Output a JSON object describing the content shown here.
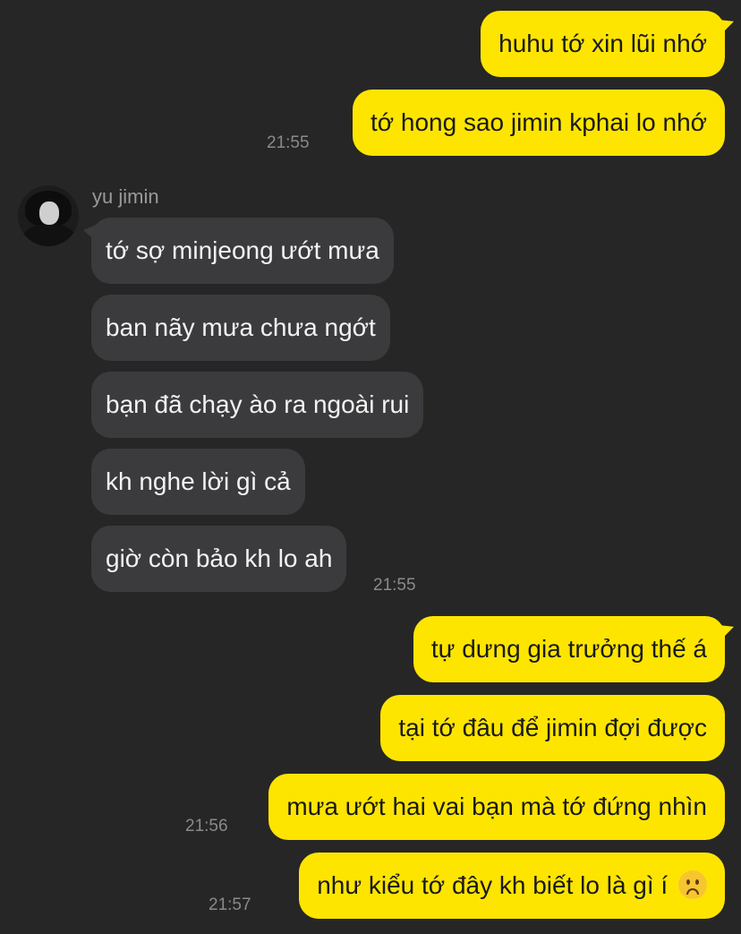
{
  "contact": {
    "name": "yu jimin"
  },
  "messages": [
    {
      "text": "huhu tớ xin lũi nhớ"
    },
    {
      "text": "tớ hong sao jimin kphai lo nhớ",
      "time": "21:55"
    },
    {
      "text": "tớ sợ minjeong ướt mưa"
    },
    {
      "text": "ban nãy mưa chưa ngớt"
    },
    {
      "text": "bạn đã chạy ào ra ngoài rui"
    },
    {
      "text": "kh nghe lời gì cả"
    },
    {
      "text": "giờ còn bảo kh lo ah",
      "time": "21:55"
    },
    {
      "text": "tự dưng gia trưởng thế á"
    },
    {
      "text": "tại tớ đâu để jimin đợi được"
    },
    {
      "text": "mưa ướt hai vai bạn mà tớ đứng nhìn",
      "time": "21:56"
    },
    {
      "text": "như kiểu tớ đây kh biết lo là gì í",
      "emoji": "slightly-frowning-face-emoji",
      "time": "21:57"
    }
  ]
}
